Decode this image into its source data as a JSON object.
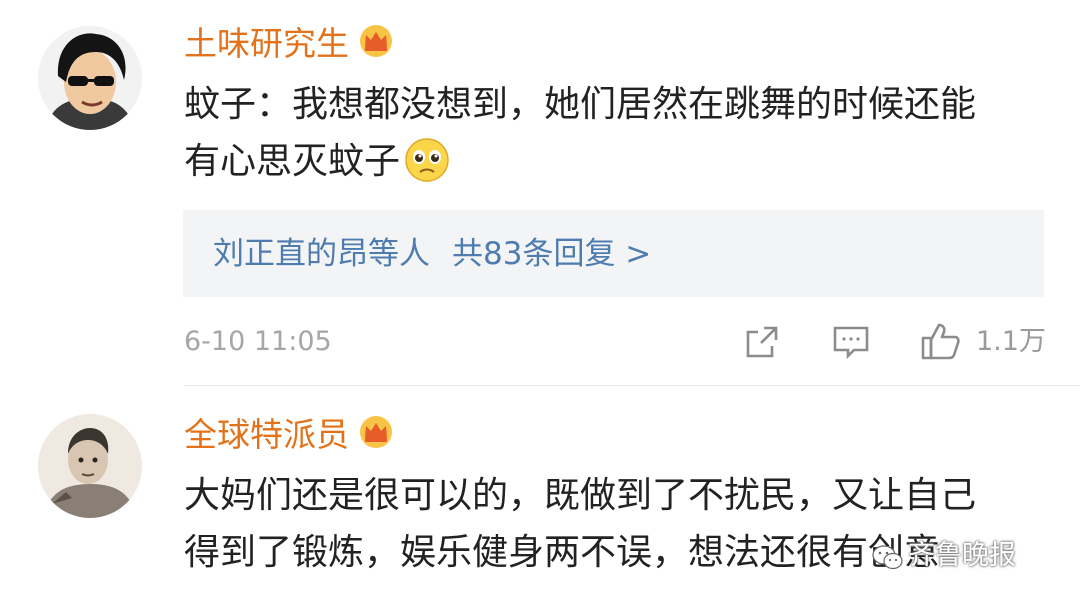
{
  "comments": [
    {
      "username": "土味研究生",
      "badge_icon": "crown-icon",
      "text_line1": "蚊子：我想都没想到，她们居然在跳舞的时候还能",
      "text_line2": "有心思灭蚊子",
      "emoji_icon": "pitiful-face-emoji",
      "reply_summary": "刘正直的昂等人",
      "reply_count_label": "共83条回复 >",
      "time": "6-10 11:05",
      "like_count": "1.1万"
    },
    {
      "username": "全球特派员",
      "badge_icon": "crown-icon",
      "text_line1": "大妈们还是很可以的，既做到了不扰民，又让自己",
      "text_line2": "得到了锻炼，娱乐健身两不误，想法还很有创意"
    }
  ],
  "watermark": {
    "text": "齐鲁晚报",
    "icon": "wechat-icon"
  },
  "colors": {
    "username": "#e2731b",
    "link": "#4f7cae",
    "meta": "#a6a6a6"
  }
}
